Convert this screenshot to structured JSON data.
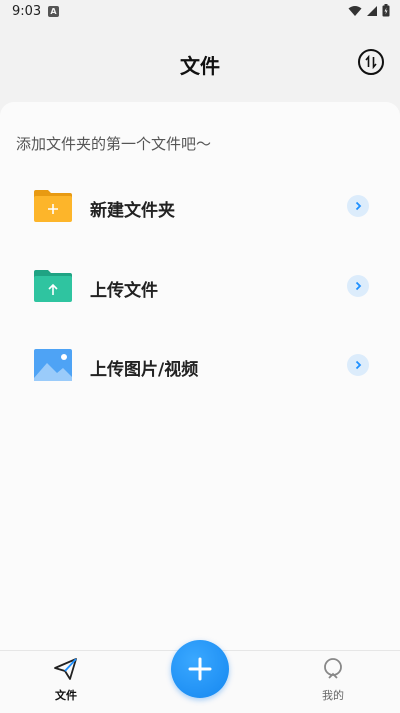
{
  "status": {
    "time": "9:03",
    "notification_icon": "A"
  },
  "header": {
    "title": "文件",
    "sort_icon": "sort-swap-icon"
  },
  "hint": "添加文件夹的第一个文件吧～",
  "actions": [
    {
      "label": "新建文件夹",
      "icon": "new-folder-icon",
      "color": "#FDB52A"
    },
    {
      "label": "上传文件",
      "icon": "upload-file-icon",
      "color": "#2FC4A0"
    },
    {
      "label": "上传图片/视频",
      "icon": "image-icon",
      "color": "#4EA3F5"
    }
  ],
  "bottom_nav": [
    {
      "label": "文件",
      "icon": "paper-plane-icon",
      "active": true
    },
    {
      "label": "我的",
      "icon": "profile-icon",
      "active": false
    }
  ],
  "colors": {
    "accent": "#1E90FF",
    "chevron_bg": "#DCECFB"
  }
}
